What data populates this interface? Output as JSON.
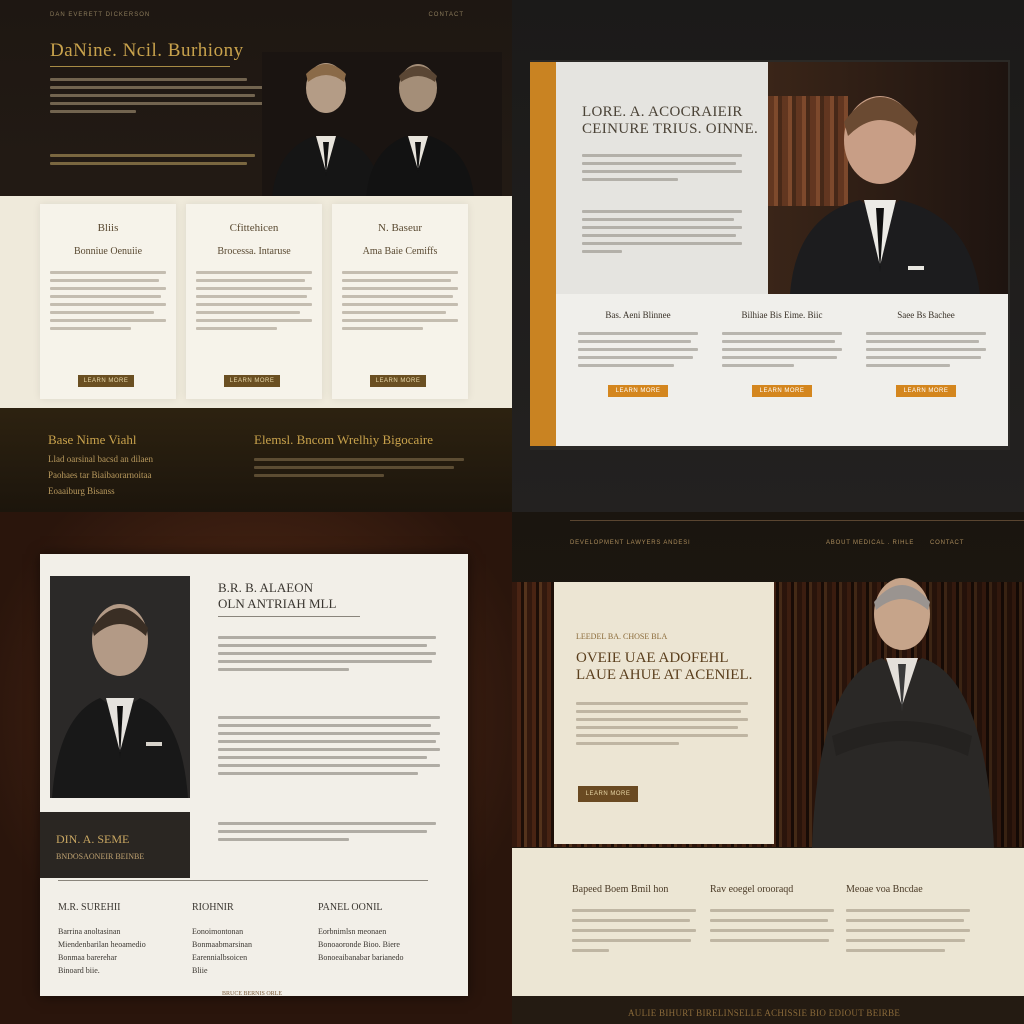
{
  "q1": {
    "nav_left": "DAN EVERETT DICKERSON",
    "nav_right": "CONTACT",
    "title": "DaNine. Ncil. Burhiony",
    "cards": [
      {
        "title": "Bliis",
        "subtitle": "Bonniue Oenuiie"
      },
      {
        "title": "Cfittehicen",
        "subtitle": "Brocessa. Intaruse"
      },
      {
        "title": "N. Baseur",
        "subtitle": "Ama Baie Cemiffs"
      }
    ],
    "footer_left_title": "Base Nime Viahl",
    "footer_left_lines": [
      "Llad oarsinal bacsd an dilaen",
      "Paohaes tar Biaibaorarnoitaa",
      "Eoaaiburg Bisanss"
    ],
    "footer_right_title": "Elemsl. Bncom Wrelhiy Bigocaire"
  },
  "q2": {
    "headline": [
      "LORE. A. ACOCRAIEIR",
      "CEINURE TRIUS. OINNE."
    ],
    "cards": [
      {
        "title": "Bas. Aeni Blinnee"
      },
      {
        "title": "Bilhiae Bis Eime. Biic"
      },
      {
        "title": "Saee Bs Bachee"
      }
    ]
  },
  "q3": {
    "name": "DIN. A. SEME",
    "role": "BNDOSAONEIR BEINBE",
    "heading": [
      "B.R. B. ALAEON",
      "OLN ANTRIAH MLL"
    ],
    "columns": [
      {
        "title": "M.R. SUREHII",
        "lines": [
          "Barrina anoltasinan",
          "Miendenbarilan heoamedio",
          "Bonmaa barerehar",
          "Binoard biie."
        ]
      },
      {
        "title": "RIOHNIR",
        "lines": [
          "Eonoimontonan",
          "Bonmaabmarsinan",
          "Earennialbsoicen",
          "Bliie"
        ]
      },
      {
        "title": "PANEL OONIL",
        "lines": [
          "Eorbnimlsn meonaen",
          "Bonoaoronde Bioo. Biere",
          "Bonoeaibanabar barianedo"
        ]
      }
    ],
    "footer": "BRUCE BERNIS ORLE"
  },
  "q4": {
    "nav_left": "DEVELOPMENT LAWYERS ANDESI",
    "nav_mid": "ABOUT MEDICAL . RIHLE",
    "nav_right": "CONTACT",
    "kicker": "LEEDEL BA. CHOSE BLA",
    "headline": [
      "OVEIE UAE ADOFEHL",
      "LAUE AHUE AT ACENIEL."
    ],
    "cols": [
      {
        "title": "Bapeed Boem Bmil hon"
      },
      {
        "title": "Rav eoegel orooraqd"
      },
      {
        "title": "Meoae voa Bncdae"
      }
    ],
    "tagline": "AULIE BIHURT BIRELINSELLE ACHISSIE BIO EDIOUT BEIRBE"
  }
}
